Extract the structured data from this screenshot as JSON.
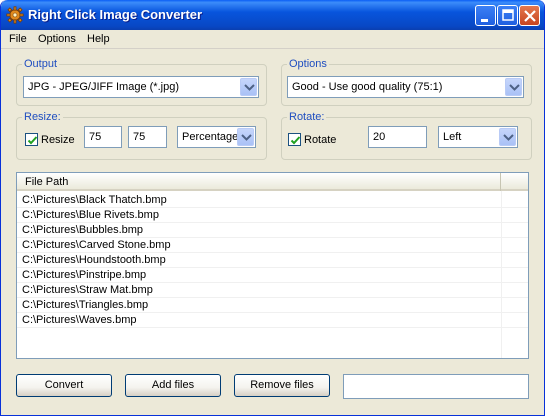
{
  "window": {
    "title": "Right Click Image Converter"
  },
  "menu": {
    "items": [
      "File",
      "Options",
      "Help"
    ]
  },
  "output": {
    "group_title": "Output",
    "selected": "JPG - JPEG/JIFF Image (*.jpg)"
  },
  "options": {
    "group_title": "Options",
    "selected": "Good - Use good quality (75:1)"
  },
  "resize": {
    "group_title": "Resize:",
    "checkbox_label": "Resize",
    "checked": true,
    "width": "75",
    "height": "75",
    "unit": "Percentage"
  },
  "rotate": {
    "group_title": "Rotate:",
    "checkbox_label": "Rotate",
    "checked": true,
    "angle": "20",
    "direction": "Left"
  },
  "file_list": {
    "header": "File Path",
    "rows": [
      "C:\\Pictures\\Black Thatch.bmp",
      "C:\\Pictures\\Blue Rivets.bmp",
      "C:\\Pictures\\Bubbles.bmp",
      "C:\\Pictures\\Carved Stone.bmp",
      "C:\\Pictures\\Houndstooth.bmp",
      "C:\\Pictures\\Pinstripe.bmp",
      "C:\\Pictures\\Straw Mat.bmp",
      "C:\\Pictures\\Triangles.bmp",
      "C:\\Pictures\\Waves.bmp"
    ]
  },
  "buttons": {
    "convert": "Convert",
    "add_files": "Add files",
    "remove_files": "Remove files"
  },
  "status": {
    "text": ""
  },
  "colors": {
    "titlebar": "#0855dd",
    "window_bg": "#ece9d8",
    "group_title": "#1f4ec0",
    "close_button": "#c7441f"
  },
  "icons": {
    "app": "gear-cog-icon",
    "minimize": "minimize-icon",
    "maximize": "maximize-icon",
    "close": "close-icon"
  }
}
